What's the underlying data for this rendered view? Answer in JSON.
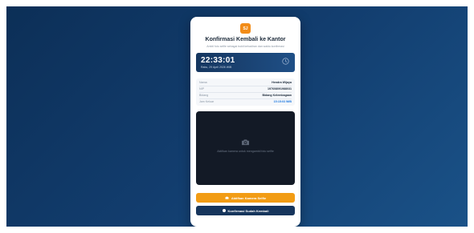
{
  "app": {
    "logo_text": "SJ",
    "title": "Konfirmasi Kembali ke Kantor",
    "subtitle": "Ambil foto selfie sebagai bukti kehadiran dan waktu konfirmasi"
  },
  "clock": {
    "time": "22:33:01",
    "date": "Rabu, 29 April 2026 WIB",
    "icon": "clock-icon"
  },
  "info": {
    "rows": [
      {
        "label": "Nama",
        "value": "Hendra Wijaya"
      },
      {
        "label": "NIP",
        "value": "197608091988031"
      },
      {
        "label": "Bidang",
        "value": "Bidang Kelembagaan"
      },
      {
        "label": "Jam Keluar",
        "value": "15:15:03 WIB"
      }
    ]
  },
  "camera": {
    "icon": "camera-icon",
    "hint": "Aktifkan kamera untuk mengambil foto selfie"
  },
  "buttons": {
    "activate_camera": "Aktifkan Kamera Selfie",
    "confirm": "Konfirmasi Sudah Kembali"
  },
  "colors": {
    "accent": "#f29c14",
    "primary": "#16355c",
    "background": "#123d6e"
  }
}
